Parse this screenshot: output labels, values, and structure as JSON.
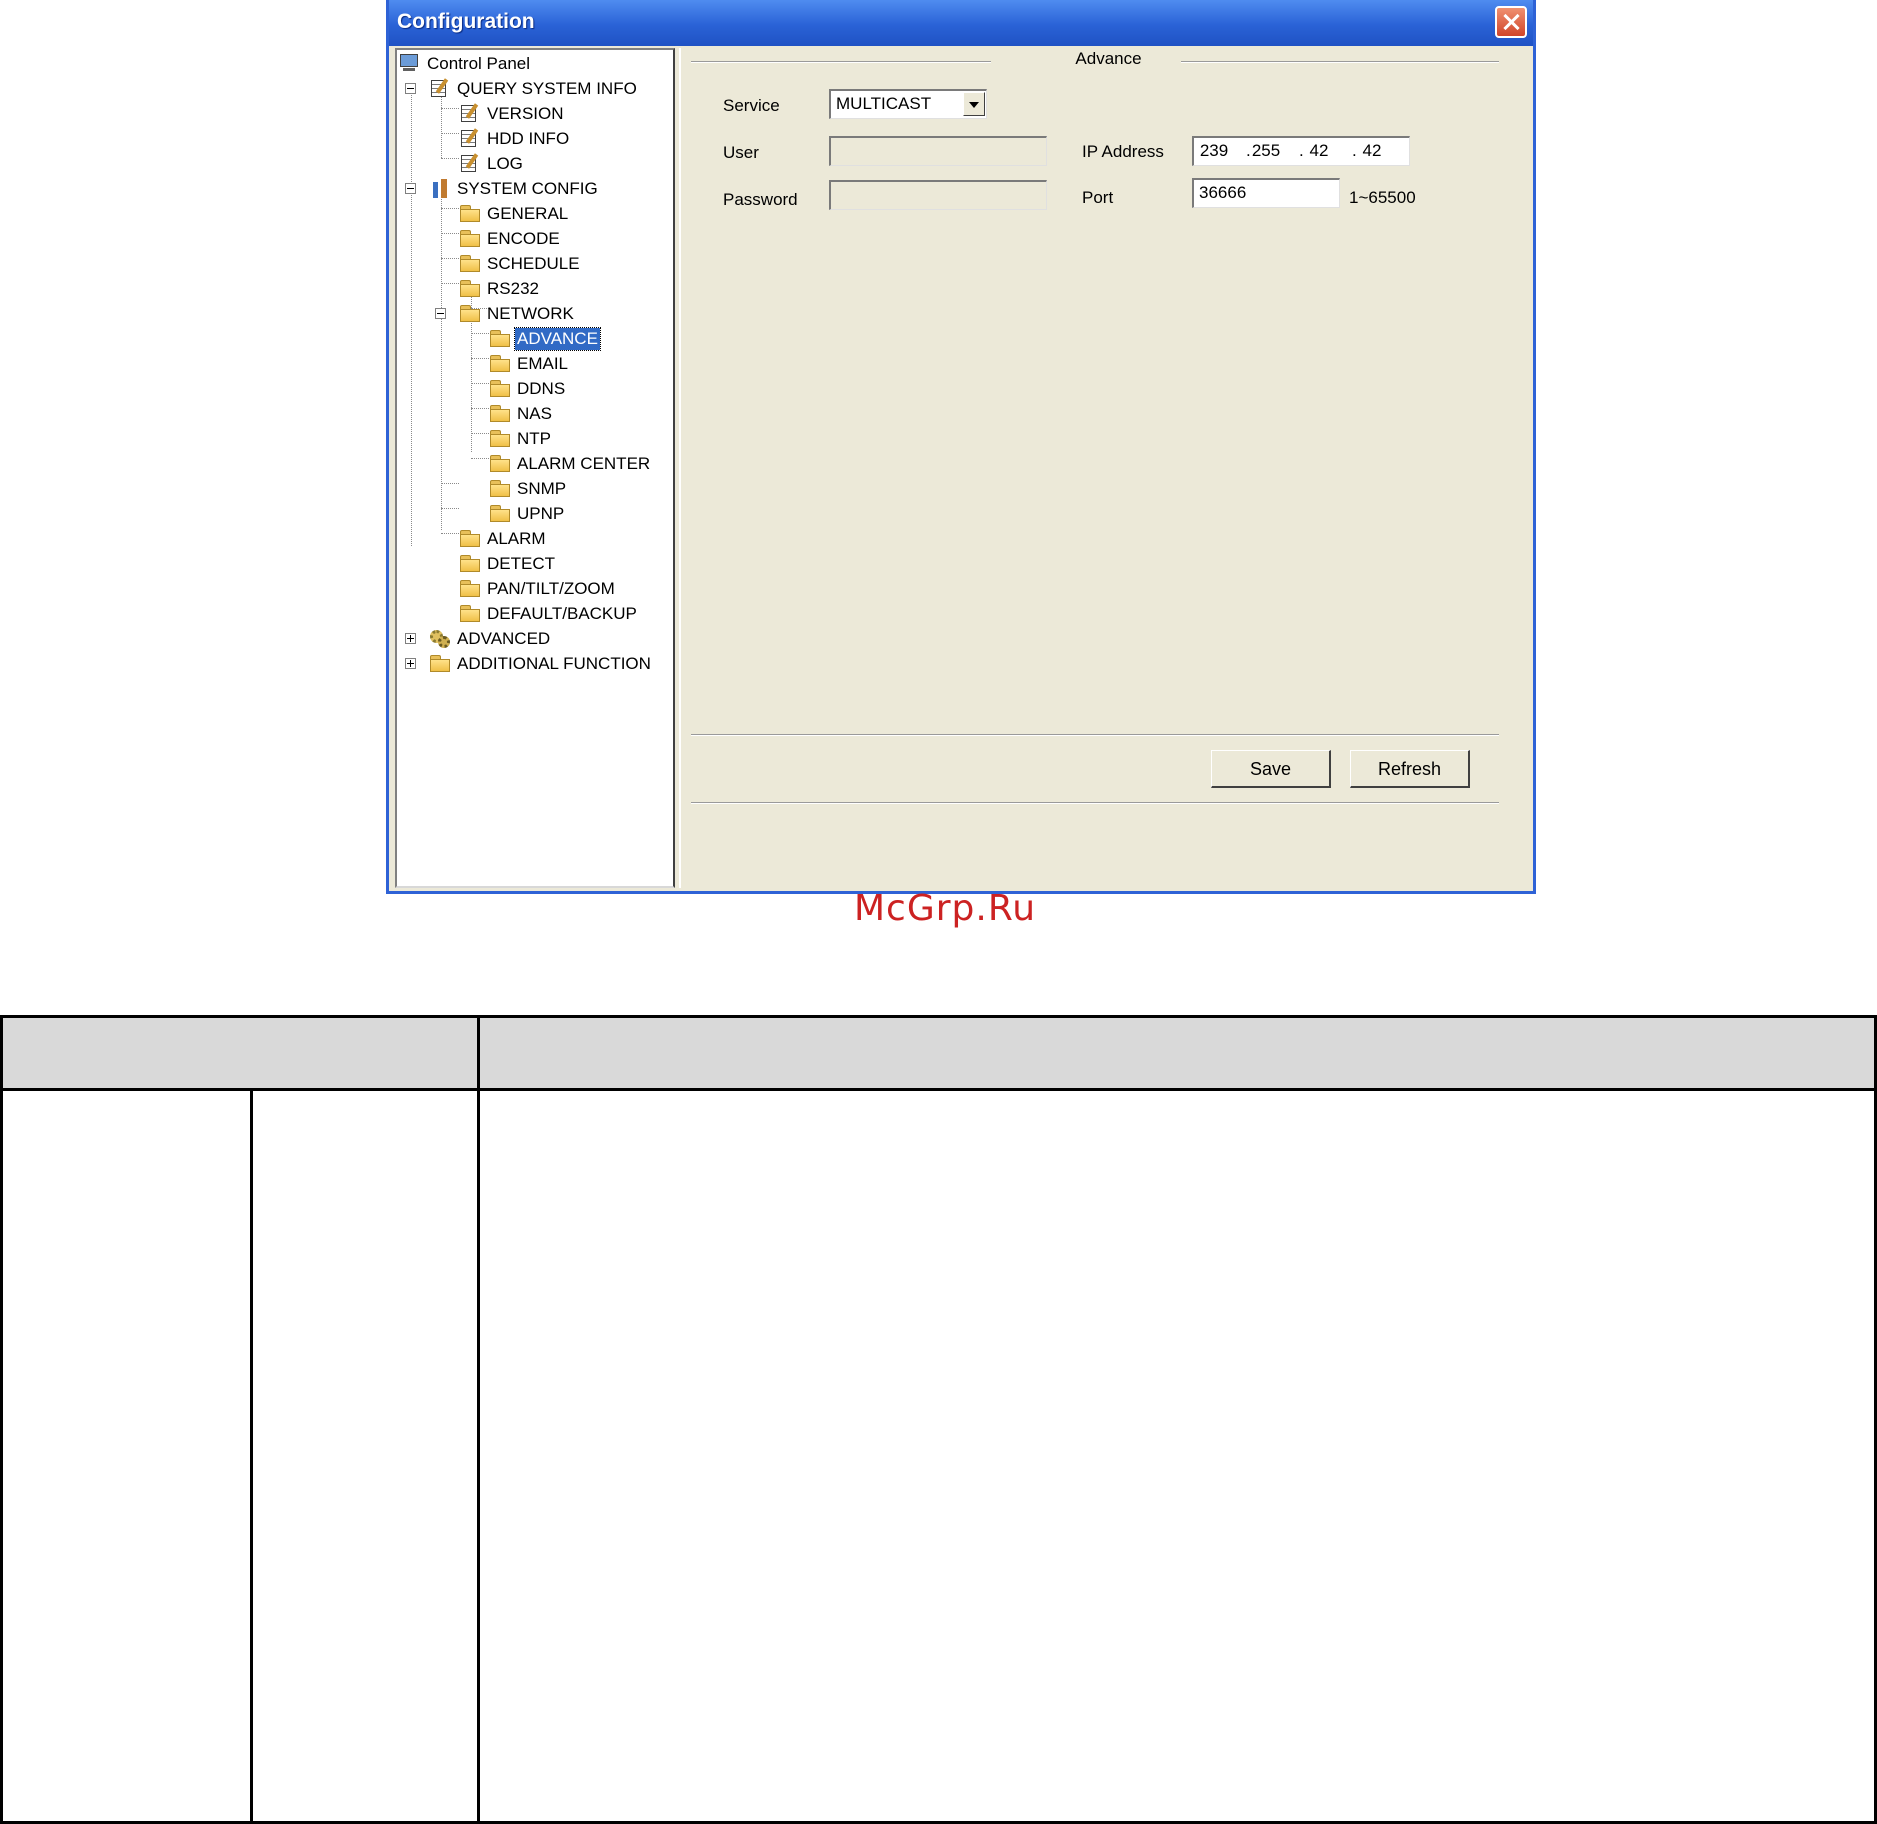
{
  "window": {
    "title": "Configuration"
  },
  "tree": {
    "items": [
      {
        "label": "Control Panel",
        "icon": "monitor-icon"
      },
      {
        "label": "QUERY SYSTEM INFO",
        "icon": "notepad-icon",
        "expanded": true
      },
      {
        "label": "VERSION",
        "icon": "notepad-icon"
      },
      {
        "label": "HDD INFO",
        "icon": "notepad-icon"
      },
      {
        "label": "LOG",
        "icon": "notepad-icon"
      },
      {
        "label": "SYSTEM CONFIG",
        "icon": "tools-icon",
        "expanded": true
      },
      {
        "label": "GENERAL",
        "icon": "folder-icon"
      },
      {
        "label": "ENCODE",
        "icon": "folder-icon"
      },
      {
        "label": "SCHEDULE",
        "icon": "folder-icon"
      },
      {
        "label": "RS232",
        "icon": "folder-icon"
      },
      {
        "label": "NETWORK",
        "icon": "folder-icon",
        "expanded": true
      },
      {
        "label": "ADVANCE",
        "icon": "folder-open-icon",
        "selected": true
      },
      {
        "label": "EMAIL",
        "icon": "folder-icon"
      },
      {
        "label": "DDNS",
        "icon": "folder-icon"
      },
      {
        "label": "NAS",
        "icon": "folder-icon"
      },
      {
        "label": "NTP",
        "icon": "folder-icon"
      },
      {
        "label": "ALARM CENTER",
        "icon": "folder-icon"
      },
      {
        "label": "SNMP",
        "icon": "folder-icon"
      },
      {
        "label": "UPNP",
        "icon": "folder-icon"
      },
      {
        "label": "ALARM",
        "icon": "folder-icon"
      },
      {
        "label": "DETECT",
        "icon": "folder-icon"
      },
      {
        "label": "PAN/TILT/ZOOM",
        "icon": "folder-icon"
      },
      {
        "label": "DEFAULT/BACKUP",
        "icon": "folder-icon"
      },
      {
        "label": "ADVANCED",
        "icon": "gears-icon",
        "expanded": false
      },
      {
        "label": "ADDITIONAL FUNCTION",
        "icon": "folder-icon",
        "expanded": false
      }
    ]
  },
  "panel": {
    "group_title": "Advance",
    "service_label": "Service",
    "service_value": "MULTICAST",
    "user_label": "User",
    "user_value": "",
    "password_label": "Password",
    "password_value": "",
    "ip_label": "IP Address",
    "ip": [
      "239",
      "255",
      "42",
      "42"
    ],
    "port_label": "Port",
    "port_value": "36666",
    "port_range": "1~65500",
    "save_label": "Save",
    "refresh_label": "Refresh"
  },
  "watermark": "McGrp.Ru"
}
